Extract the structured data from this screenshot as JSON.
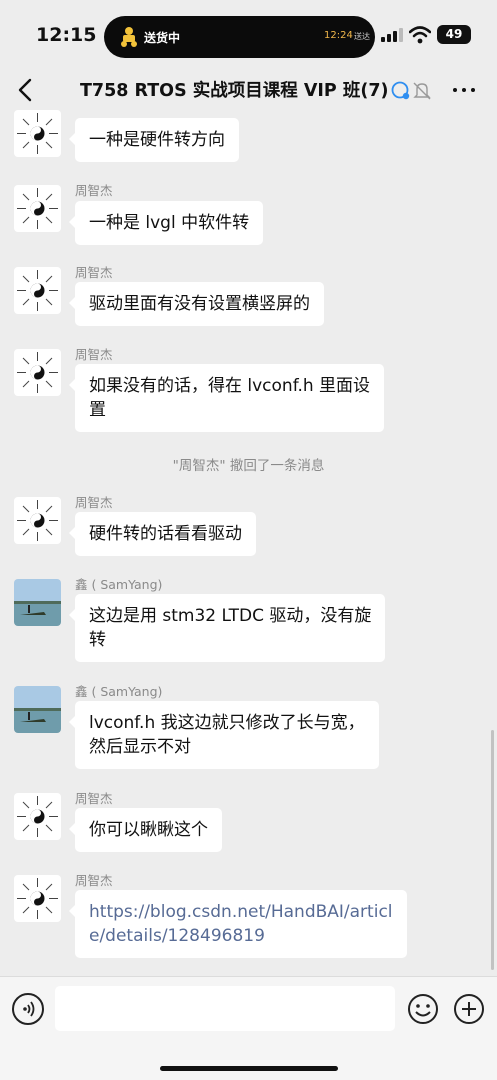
{
  "status_bar": {
    "time": "12:15",
    "island_label": "送货中",
    "island_time": "12:24",
    "island_suffix": "送达",
    "battery": "49"
  },
  "header": {
    "title": "T758 RTOS 实战项目课程 VIP 班(7)"
  },
  "messages": [
    {
      "sender": "",
      "text": "一种是硬件转方向",
      "avatar": "taiji-avatar"
    },
    {
      "sender": "周智杰",
      "text": "一种是 lvgl 中软件转",
      "avatar": "taiji-avatar"
    },
    {
      "sender": "周智杰",
      "text": "驱动里面有没有设置横竖屏的",
      "avatar": "taiji-avatar"
    },
    {
      "sender": "周智杰",
      "text_lines": [
        "如果没有的话，得在 lvconf.h 里面设",
        "置"
      ],
      "avatar": "taiji-avatar"
    },
    {
      "sender": "周智杰",
      "text": "硬件转的话看看驱动",
      "avatar": "taiji-avatar"
    },
    {
      "sender": "鑫 ( SamYang)",
      "text_lines": [
        "这边是用 stm32 LTDC 驱动，没有旋",
        "转"
      ],
      "avatar": "lake-photo-avatar"
    },
    {
      "sender": "鑫 ( SamYang)",
      "text_lines": [
        "lvconf.h 我这边就只修改了长与宽，",
        "然后显示不对"
      ],
      "avatar": "lake-photo-avatar"
    },
    {
      "sender": "周智杰",
      "text": "你可以瞅瞅这个",
      "avatar": "taiji-avatar"
    },
    {
      "sender": "周智杰",
      "text_lines": [
        "https://blog.csdn.net/HandBAI/articl",
        "e/details/128496819"
      ],
      "avatar": "taiji-avatar",
      "is_link": true
    }
  ],
  "system_notice": "\"周智杰\" 撤回了一条消息",
  "colors": {
    "background": "#ededed",
    "bubble": "#ffffff",
    "link": "#576b95",
    "meta_text": "#8a8a8a"
  },
  "icons": [
    "back-arrow-icon",
    "mention-icon",
    "mute-bell-icon",
    "more-dots-icon",
    "voice-icon",
    "emoji-icon",
    "plus-icon"
  ]
}
